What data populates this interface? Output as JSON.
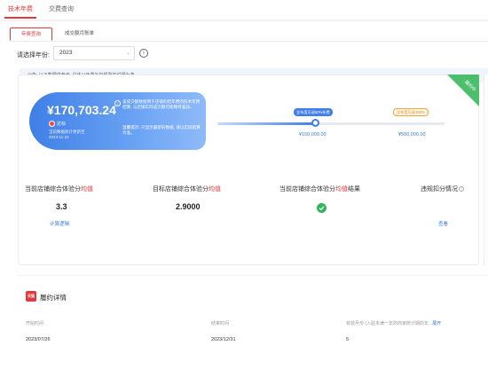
{
  "top_tabs": [
    {
      "label": "技术年费",
      "active": true
    },
    {
      "label": "交费查询",
      "active": false
    }
  ],
  "sub_tabs": [
    {
      "label": "年费查询",
      "active": true
    },
    {
      "label": "成交额月账单",
      "active": false
    }
  ],
  "filter": {
    "label": "请选择年份:",
    "year": "2023"
  },
  "notice": {
    "text": "公告: 以下数据供参考, 具体以年费补扣规则的说明为准。",
    "link": "年费补扣规则的说明"
  },
  "ribbon": {
    "text": "履约中"
  },
  "summary": {
    "amount": "¥170,703.24",
    "status": "达标",
    "dates_line1": "当前数据统计更新至",
    "dates_line2": "2023-11-22",
    "tip1": "该成交额数据用于店铺的结年费的技术年费结算, 与店铺实际成交额可能略有差异。",
    "tip2": "温馨提示: 只显示最新的数据, 请以实际结算为准。"
  },
  "progress": {
    "fraction": 0.43,
    "current_bubble": "全年度可退50%年费",
    "target_bubble": "全年度可退100%",
    "mark1": "¥150,000.00",
    "mark2": "¥500,000.00"
  },
  "metrics": [
    {
      "title_prefix": "当前店铺综合体验分",
      "title_red": "均值",
      "value": "3.3",
      "link": "计算逻辑"
    },
    {
      "title_prefix": "目标店铺综合体验分",
      "title_red": "均值",
      "value": "2.9000"
    },
    {
      "title_prefix": "当前店铺综合体验分",
      "title_red": "均值",
      "title_suffix": "结果",
      "result": "pass"
    },
    {
      "title_prefix": "违规扣分情况",
      "link": "查看"
    }
  ],
  "details": {
    "logo": "天猫",
    "title": "履约详情",
    "columns": [
      {
        "label": "开始时间",
        "value": "2023/07/26"
      },
      {
        "label": "结束时间",
        "value": "2023/12/31"
      },
      {
        "label": "有效月份 (入驻未满一年的商家统计期的年...",
        "link": "展开",
        "value": "5"
      }
    ]
  },
  "colors": {
    "accent_red": "#e4393c",
    "brand_blue": "#3f7fe6",
    "success_green": "#2fb55a",
    "ribbon_green": "#4cbf6c"
  }
}
